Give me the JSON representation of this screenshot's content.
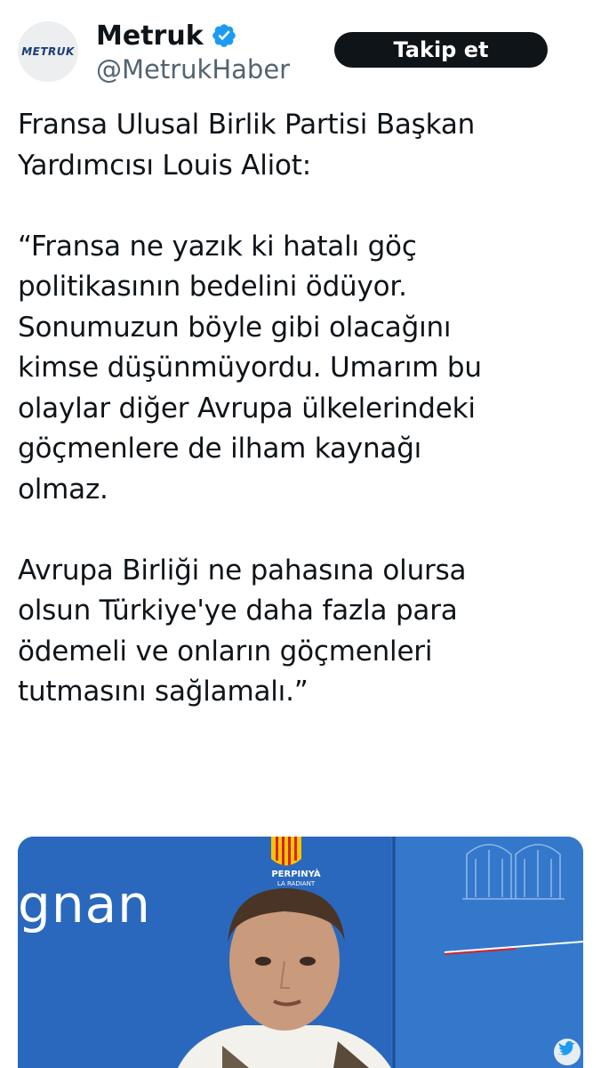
{
  "account": {
    "avatar_text": "METRUK",
    "display_name": "Metruk",
    "handle": "@MetrukHaber",
    "verified_icon": "verified-badge-icon"
  },
  "actions": {
    "follow_label": "Takip et"
  },
  "tweet": {
    "lines_p1": [
      "Fransa Ulusal Birlik Partisi Başkan",
      "Yardımcısı Louis Aliot:"
    ],
    "lines_p2": [
      "“Fransa ne yazık ki hatalı göç",
      "politikasının bedelini ödüyor.",
      "Sonumuzun böyle gibi olacağını",
      "kimse düşünmüyordu. Umarım bu",
      "olaylar diğer Avrupa ülkelerindeki",
      "göçmenlere de ilham kaynağı",
      "olmaz."
    ],
    "lines_p3": [
      "Avrupa Birliği ne pahasına olursa",
      "olsun Türkiye'ye daha fazla para",
      "ödemeli ve onların göçmenleri",
      "tutmasını sağlamalı.”"
    ]
  },
  "media": {
    "banner_text": "gnan",
    "logo_text_top": "PERPINYÀ",
    "logo_text_bottom": "LA RADIANT",
    "watermark_icon": "twitter-bird-icon"
  },
  "colors": {
    "follow_bg": "#0f1419",
    "verified": "#1d9bf0",
    "handle": "#536471",
    "media_blue": "#2d6fc4"
  }
}
